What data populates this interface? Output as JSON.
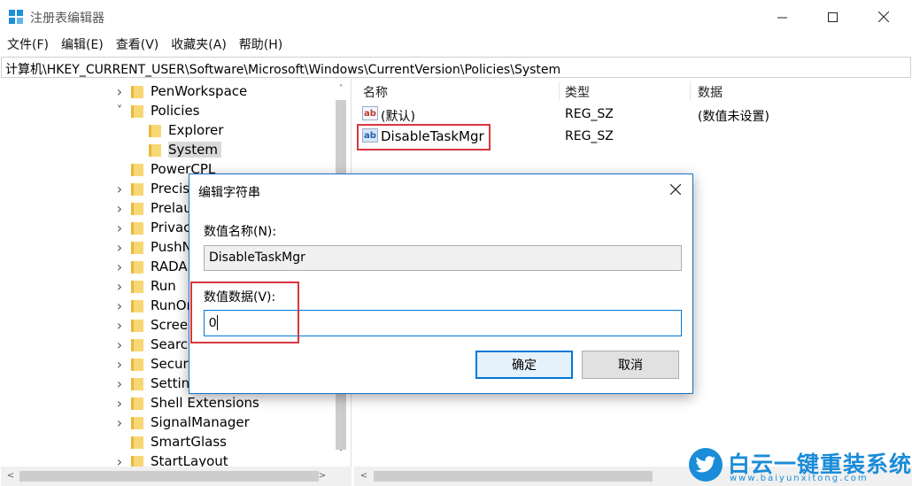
{
  "window": {
    "title": "注册表编辑器",
    "icon": "regedit-icon"
  },
  "menu": [
    "文件(F)",
    "编辑(E)",
    "查看(V)",
    "收藏夹(A)",
    "帮助(H)"
  ],
  "address": "计算机\\HKEY_CURRENT_USER\\Software\\Microsoft\\Windows\\CurrentVersion\\Policies\\System",
  "tree": {
    "items": [
      {
        "label": "PenWorkspace",
        "chevron": ">"
      },
      {
        "label": "Policies",
        "chevron": "v"
      },
      {
        "label": "Explorer",
        "chevron": ""
      },
      {
        "label": "System",
        "chevron": "",
        "selected": true
      },
      {
        "label": "PowerCPL",
        "chevron": ""
      },
      {
        "label": "Precis",
        "chevron": ">"
      },
      {
        "label": "Prelau",
        "chevron": ">"
      },
      {
        "label": "Privac",
        "chevron": ">"
      },
      {
        "label": "PushN",
        "chevron": ">"
      },
      {
        "label": "RADA",
        "chevron": ">"
      },
      {
        "label": "Run",
        "chevron": ">"
      },
      {
        "label": "RunOr",
        "chevron": ">"
      },
      {
        "label": "Scree",
        "chevron": ">"
      },
      {
        "label": "Searc",
        "chevron": ">"
      },
      {
        "label": "Securi",
        "chevron": ">"
      },
      {
        "label": "Settin",
        "chevron": ">"
      },
      {
        "label": "Shell Extensions",
        "chevron": ">"
      },
      {
        "label": "SignalManager",
        "chevron": ">"
      },
      {
        "label": "SmartGlass",
        "chevron": ""
      },
      {
        "label": "StartLayout",
        "chevron": ">"
      }
    ]
  },
  "list": {
    "columns": [
      "名称",
      "类型",
      "数据"
    ],
    "rows": [
      {
        "name": "(默认)",
        "type": "REG_SZ",
        "data": "(数值未设置)",
        "icon": "ab"
      },
      {
        "name": "DisableTaskMgr",
        "type": "REG_SZ",
        "data": "",
        "icon": "ab"
      }
    ]
  },
  "dialog": {
    "title": "编辑字符串",
    "name_label": "数值名称(N):",
    "name_value": "DisableTaskMgr",
    "data_label": "数值数据(V):",
    "data_value": "0",
    "ok_label": "确定",
    "cancel_label": "取消"
  },
  "watermark": {
    "brand": "白云一键重装系统",
    "url": "www.baiyunxitong.com"
  },
  "colors": {
    "accent": "#0078d7",
    "highlight": "#d9363e",
    "folder": "#f8d775",
    "brand": "#1a8cd8"
  }
}
